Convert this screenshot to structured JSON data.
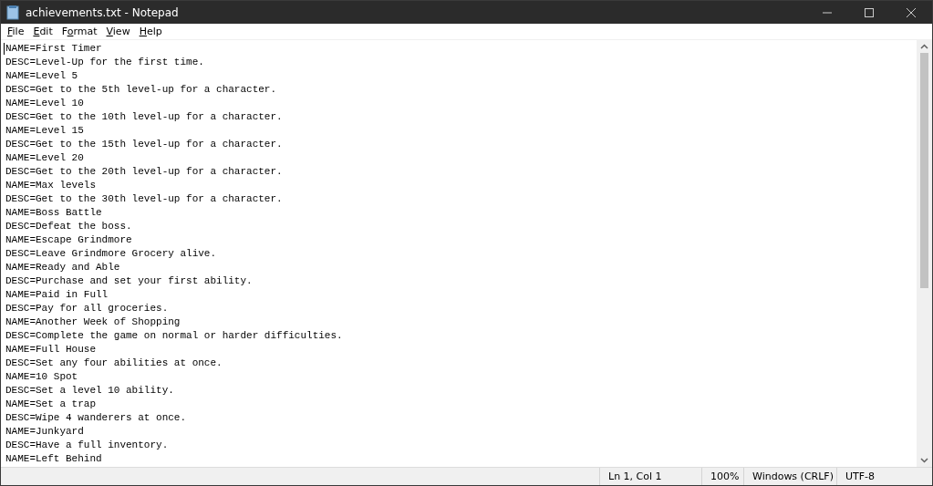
{
  "window": {
    "title": "achievements.txt - Notepad"
  },
  "menu": [
    "File",
    "Edit",
    "Format",
    "View",
    "Help"
  ],
  "lines": [
    "NAME=First Timer",
    "DESC=Level-Up for the first time.",
    "NAME=Level 5",
    "DESC=Get to the 5th level-up for a character.",
    "NAME=Level 10",
    "DESC=Get to the 10th level-up for a character.",
    "NAME=Level 15",
    "DESC=Get to the 15th level-up for a character.",
    "NAME=Level 20",
    "DESC=Get to the 20th level-up for a character.",
    "NAME=Max levels",
    "DESC=Get to the 30th level-up for a character.",
    "NAME=Boss Battle",
    "DESC=Defeat the boss.",
    "NAME=Escape Grindmore",
    "DESC=Leave Grindmore Grocery alive.",
    "NAME=Ready and Able",
    "DESC=Purchase and set your first ability.",
    "NAME=Paid in Full",
    "DESC=Pay for all groceries.",
    "NAME=Another Week of Shopping",
    "DESC=Complete the game on normal or harder difficulties.",
    "NAME=Full House",
    "DESC=Set any four abilities at once.",
    "NAME=10 Spot",
    "DESC=Set a level 10 ability.",
    "NAME=Set a trap",
    "DESC=Wipe 4 wanderers at once.",
    "NAME=Junkyard",
    "DESC=Have a full inventory.",
    "NAME=Left Behind"
  ],
  "status_bar": [
    "Ln 1, Col 1",
    "100%",
    "Windows (CRLF)",
    "UTF-8"
  ]
}
